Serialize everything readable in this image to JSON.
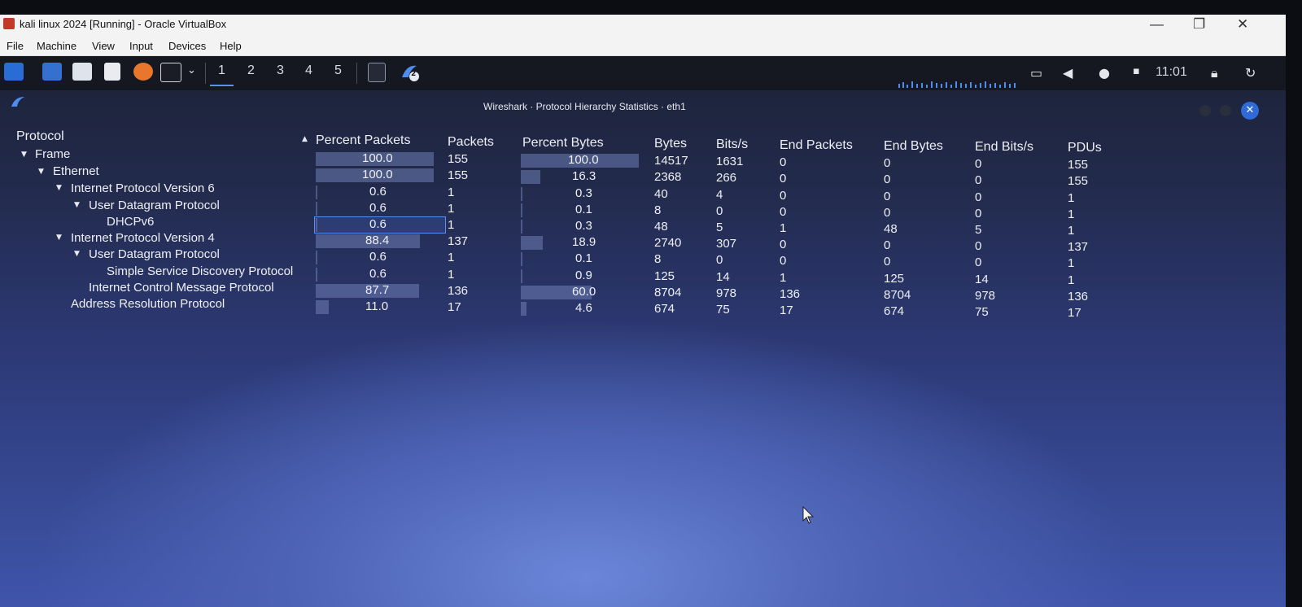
{
  "host": {
    "window_title": "kali linux 2024 [Running] - Oracle VirtualBox",
    "menu": [
      "File",
      "Machine",
      "View",
      "Input",
      "Devices",
      "Help"
    ]
  },
  "panel": {
    "workspaces": [
      "1",
      "2",
      "3",
      "4",
      "5"
    ],
    "active_workspace": "1",
    "clock": "11:01",
    "badge": "2"
  },
  "window": {
    "title": "Wireshark · Protocol Hierarchy Statistics · eth1"
  },
  "table": {
    "headers": {
      "protocol": "Protocol",
      "percent_packets": "Percent Packets",
      "packets": "Packets",
      "percent_bytes": "Percent Bytes",
      "bytes": "Bytes",
      "bits_s": "Bits/s",
      "end_packets": "End Packets",
      "end_bytes": "End Bytes",
      "end_bits_s": "End Bits/s",
      "pdus": "PDUs"
    },
    "rows": [
      {
        "name": "Frame",
        "pct_packets": "100.0",
        "packets": "155",
        "pct_bytes": "100.0",
        "bytes": "14517",
        "bits_s": "1631",
        "end_packets": "0",
        "end_bytes": "0",
        "end_bits_s": "0",
        "pdus": "155"
      },
      {
        "name": "Ethernet",
        "pct_packets": "100.0",
        "packets": "155",
        "pct_bytes": "16.3",
        "bytes": "2368",
        "bits_s": "266",
        "end_packets": "0",
        "end_bytes": "0",
        "end_bits_s": "0",
        "pdus": "155"
      },
      {
        "name": "Internet Protocol Version 6",
        "pct_packets": "0.6",
        "packets": "1",
        "pct_bytes": "0.3",
        "bytes": "40",
        "bits_s": "4",
        "end_packets": "0",
        "end_bytes": "0",
        "end_bits_s": "0",
        "pdus": "1"
      },
      {
        "name": "User Datagram Protocol",
        "pct_packets": "0.6",
        "packets": "1",
        "pct_bytes": "0.1",
        "bytes": "8",
        "bits_s": "0",
        "end_packets": "0",
        "end_bytes": "0",
        "end_bits_s": "0",
        "pdus": "1"
      },
      {
        "name": "DHCPv6",
        "pct_packets": "0.6",
        "packets": "1",
        "pct_bytes": "0.3",
        "bytes": "48",
        "bits_s": "5",
        "end_packets": "1",
        "end_bytes": "48",
        "end_bits_s": "5",
        "pdus": "1"
      },
      {
        "name": "Internet Protocol Version 4",
        "pct_packets": "88.4",
        "packets": "137",
        "pct_bytes": "18.9",
        "bytes": "2740",
        "bits_s": "307",
        "end_packets": "0",
        "end_bytes": "0",
        "end_bits_s": "0",
        "pdus": "137"
      },
      {
        "name": "User Datagram Protocol",
        "pct_packets": "0.6",
        "packets": "1",
        "pct_bytes": "0.1",
        "bytes": "8",
        "bits_s": "0",
        "end_packets": "0",
        "end_bytes": "0",
        "end_bits_s": "0",
        "pdus": "1"
      },
      {
        "name": "Simple Service Discovery Protocol",
        "pct_packets": "0.6",
        "packets": "1",
        "pct_bytes": "0.9",
        "bytes": "125",
        "bits_s": "14",
        "end_packets": "1",
        "end_bytes": "125",
        "end_bits_s": "14",
        "pdus": "1"
      },
      {
        "name": "Internet Control Message Protocol",
        "pct_packets": "87.7",
        "packets": "136",
        "pct_bytes": "60.0",
        "bytes": "8704",
        "bits_s": "978",
        "end_packets": "136",
        "end_bytes": "8704",
        "end_bits_s": "978",
        "pdus": "136"
      },
      {
        "name": "Address Resolution Protocol",
        "pct_packets": "11.0",
        "packets": "17",
        "pct_bytes": "4.6",
        "bytes": "674",
        "bits_s": "75",
        "end_packets": "17",
        "end_bytes": "674",
        "end_bits_s": "75",
        "pdus": "17"
      }
    ]
  }
}
